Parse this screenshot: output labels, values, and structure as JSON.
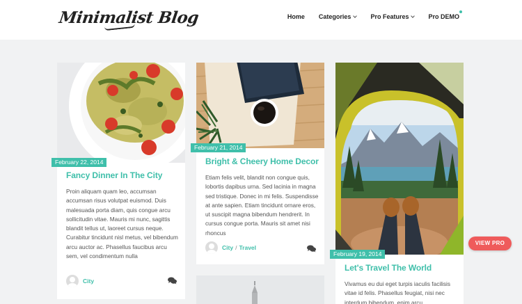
{
  "header": {
    "logo": "Minimalist Blog",
    "nav": [
      {
        "label": "Home",
        "dropdown": false
      },
      {
        "label": "Categories",
        "dropdown": true
      },
      {
        "label": "Pro Features",
        "dropdown": true
      },
      {
        "label": "Pro DEMO",
        "dropdown": false
      }
    ]
  },
  "posts": [
    {
      "date": "February 22, 2014",
      "title": "Fancy Dinner In The City",
      "paragraphs": [
        "Proin aliquam quam leo, accumsan accumsan risus volutpat euismod. Duis malesuada porta diam, quis congue arcu sollicitudin vitae. Mauris mi nunc, sagittis blandit tellus ut, laoreet cursus neque. Curabitur tincidunt nisl metus, vel bibendum arcu auctor ac. Phasellus faucibus arcu sem, vel condimentum nulla"
      ],
      "categories": [
        "City"
      ]
    },
    {
      "date": "February 21, 2014",
      "title": "Bright & Cheery Home Decor",
      "paragraphs": [
        "Etiam felis velit, blandit non congue quis, lobortis dapibus urna. Sed lacinia in magna sed tristique. Donec in mi felis. Suspendisse at ante sapien. Etiam tincidunt ornare eros, ut suscipit magna bibendum hendrerit. In cursus congue porta. Mauris sit amet nisi rhoncus"
      ],
      "categories": [
        "City",
        "Travel"
      ]
    },
    {
      "date": "February 19, 2014",
      "title": "Let's Travel The World",
      "paragraphs": [
        "Vivamus eu dui eget turpis iaculis facilisis vitae id felis. Phasellus feugiat, nisi nec interdum bibendum, enim arcu"
      ],
      "categories": []
    }
  ],
  "view_pro": "VIEW PRO",
  "colors": {
    "accent": "#3fbfaa",
    "pro_button": "#ef5b5b",
    "background": "#f1f2f3"
  }
}
